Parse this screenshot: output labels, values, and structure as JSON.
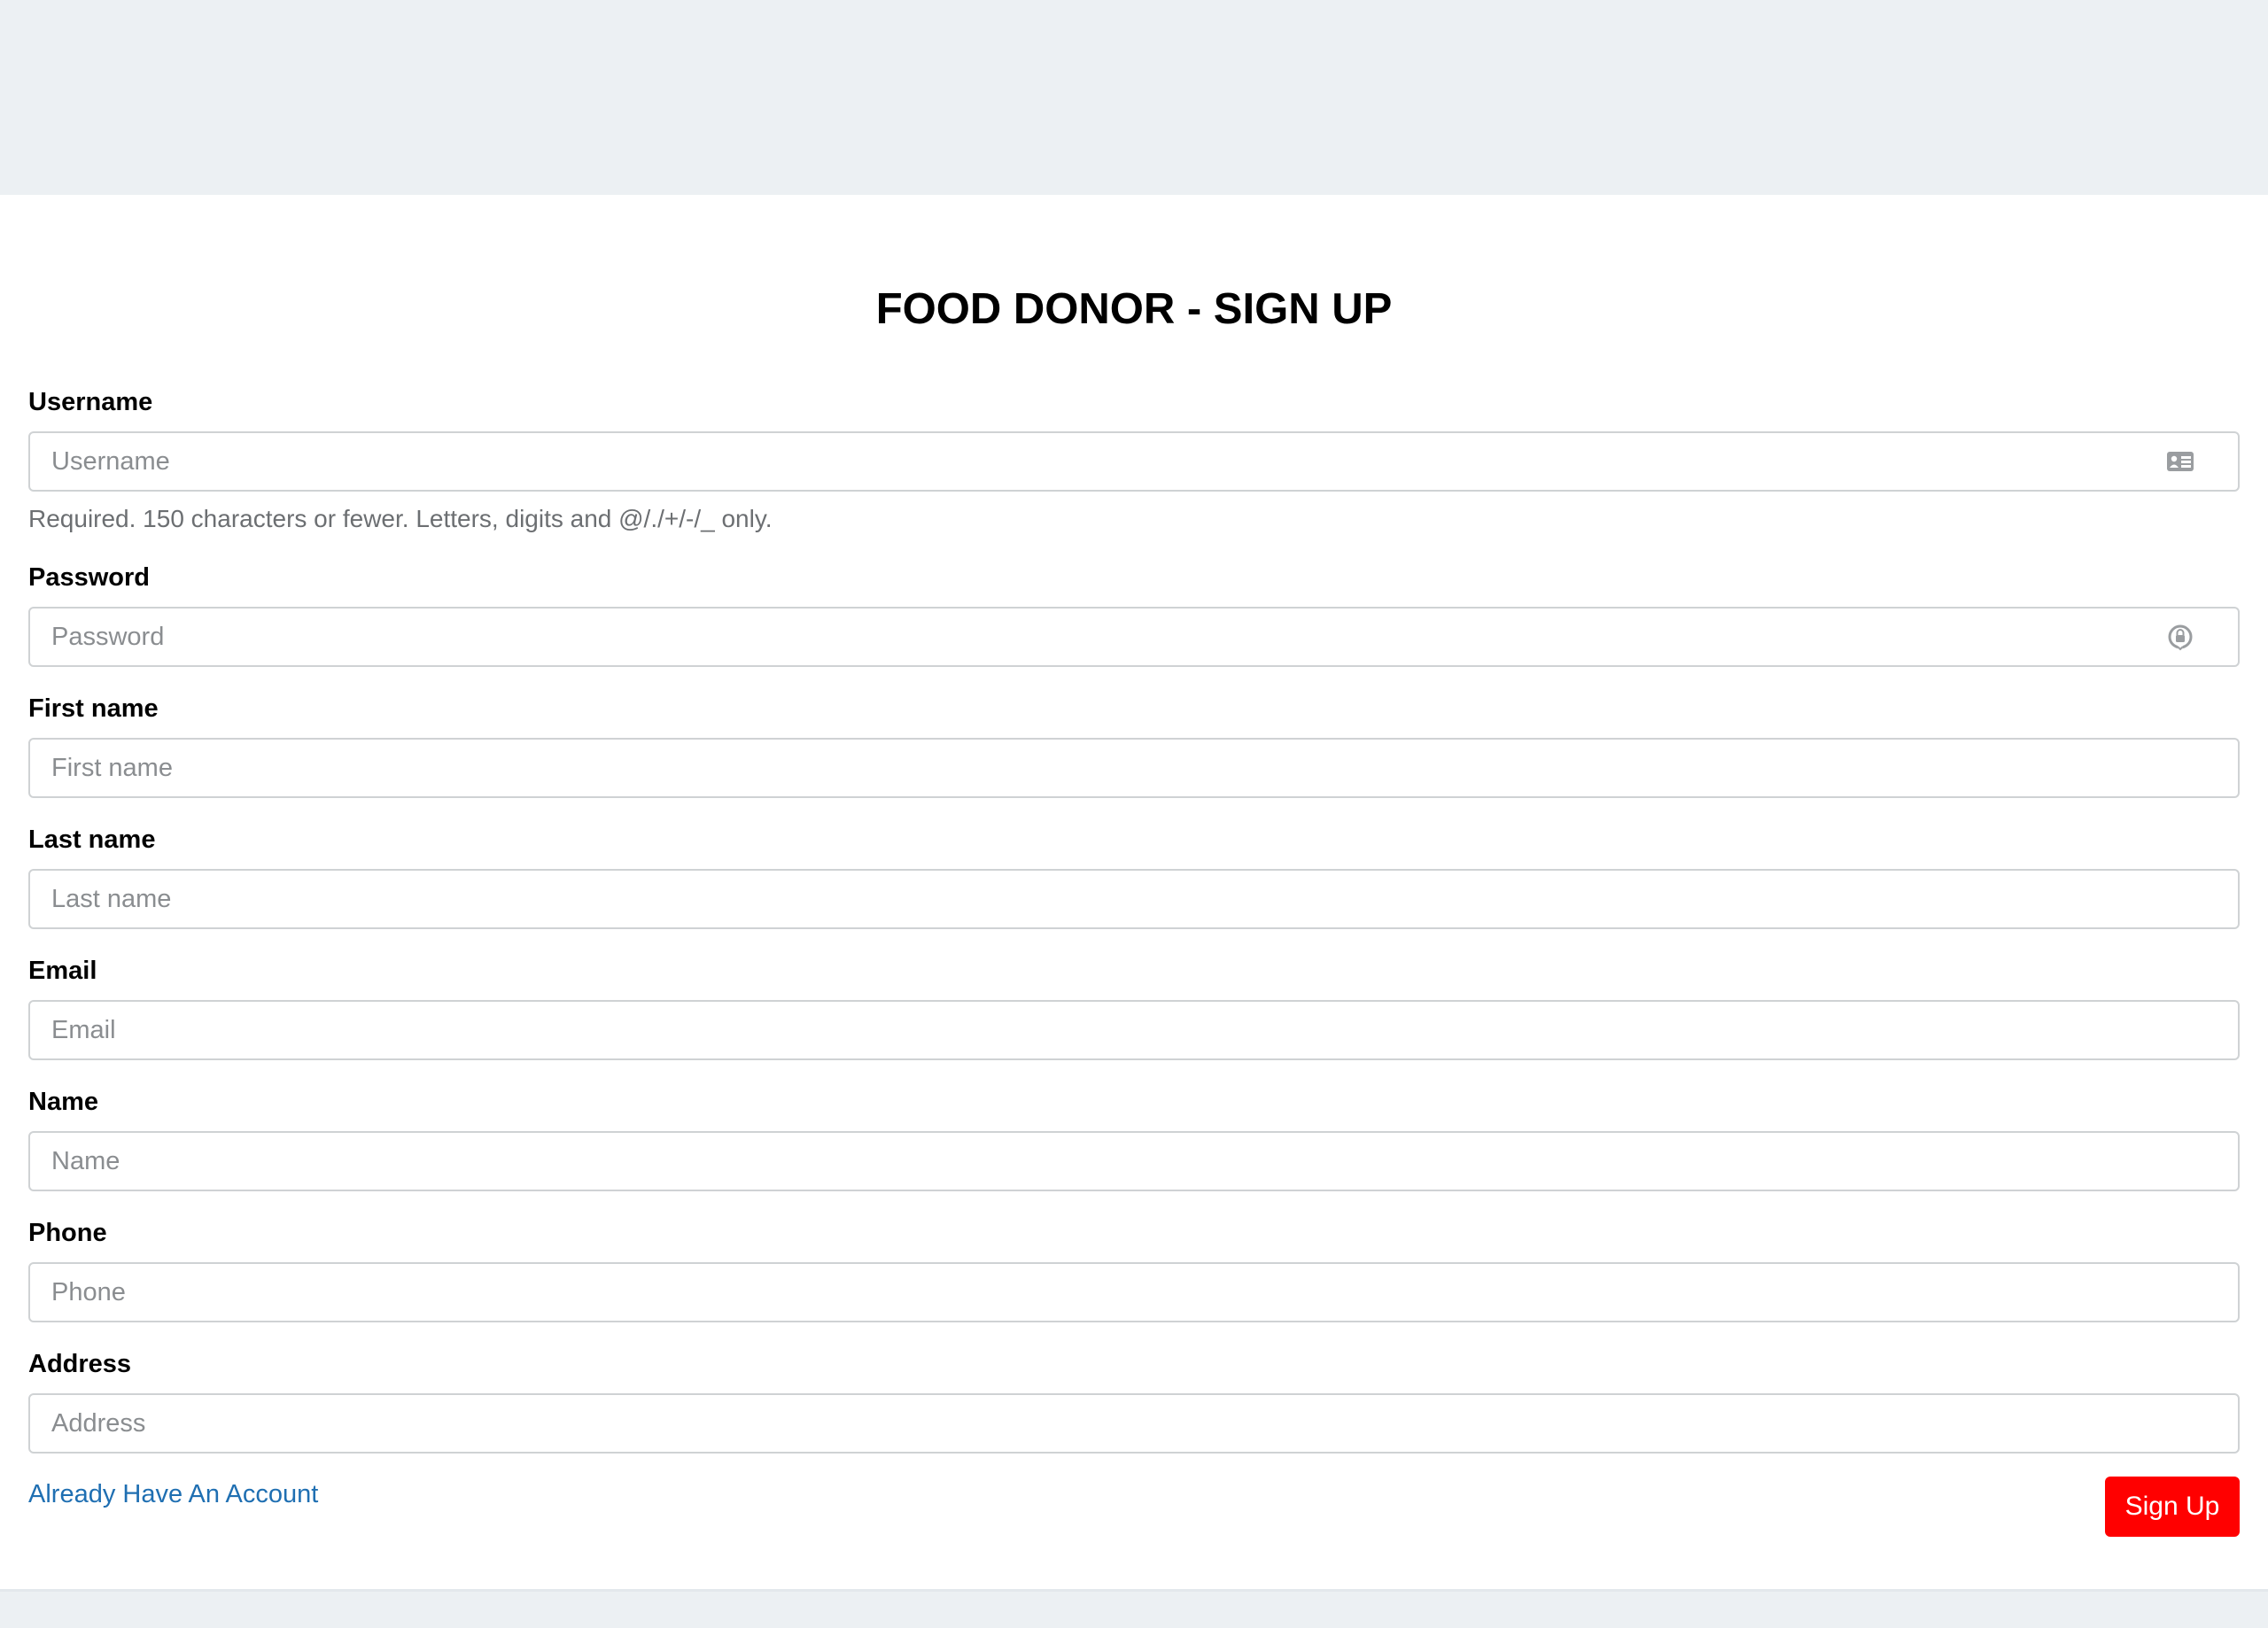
{
  "form": {
    "title": "FOOD DONOR - SIGN UP",
    "fields": {
      "username": {
        "label": "Username",
        "placeholder": "Username",
        "help": "Required. 150 characters or fewer. Letters, digits and @/./+/-/_ only.",
        "icon": "contact-card-icon"
      },
      "password": {
        "label": "Password",
        "placeholder": "Password",
        "icon": "password-key-icon"
      },
      "first_name": {
        "label": "First name",
        "placeholder": "First name"
      },
      "last_name": {
        "label": "Last name",
        "placeholder": "Last name"
      },
      "email": {
        "label": "Email",
        "placeholder": "Email"
      },
      "name": {
        "label": "Name",
        "placeholder": "Name"
      },
      "phone": {
        "label": "Phone",
        "placeholder": "Phone"
      },
      "address": {
        "label": "Address",
        "placeholder": "Address"
      }
    },
    "signin_link_label": "Already Have An Account",
    "submit_label": "Sign Up"
  },
  "colors": {
    "page_background": "#ecf0f3",
    "card_background": "#ffffff",
    "link": "#1f6fb2",
    "submit_button": "#ff0000",
    "input_border": "#cfd2d4"
  }
}
